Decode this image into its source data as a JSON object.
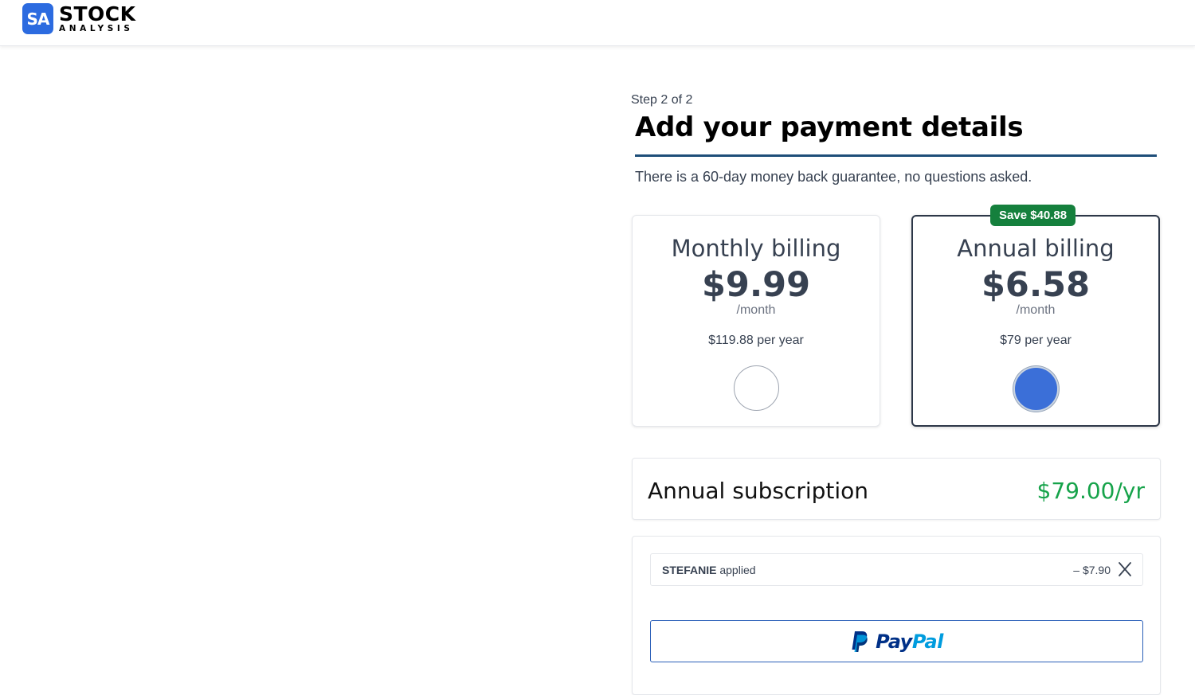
{
  "brand": {
    "badge": "SA",
    "name_top": "STOCK",
    "name_bottom": "ANALYSIS",
    "accent_color": "#2c6be0"
  },
  "checkout": {
    "step": "Step 2 of 2",
    "title": "Add your payment details",
    "guarantee": "There is a 60-day money back guarantee, no questions asked."
  },
  "plans": {
    "monthly": {
      "name": "Monthly billing",
      "price": "$9.99",
      "per": "/month",
      "yearly": "$119.88 per year",
      "selected": false
    },
    "annual": {
      "name": "Annual billing",
      "price": "$6.58",
      "per": "/month",
      "yearly": "$79 per year",
      "badge": "Save $40.88",
      "badge_color": "#15803d",
      "selected": true
    }
  },
  "summary": {
    "label": "Annual subscription",
    "price": "$79.00/yr",
    "price_color": "#16a34a"
  },
  "coupon": {
    "code": "STEFANIE",
    "status": "applied",
    "discount": "– $7.90",
    "remove_icon": "close-icon"
  },
  "payment": {
    "paypal_pay": "Pay",
    "paypal_pal": "Pal",
    "paypal_icon": "paypal-icon"
  }
}
